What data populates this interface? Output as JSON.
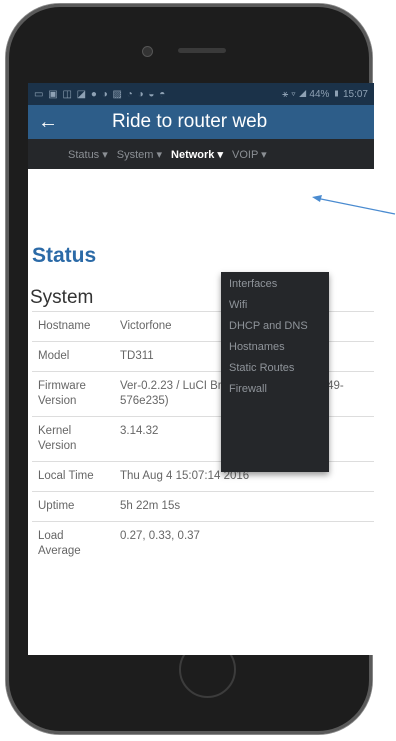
{
  "statusbar": {
    "left_icons": "▭ ▣ ◫ ◪ ● ◑ ▨ ◔ ◑ ◒ ◓",
    "right_text": "⚹ ▿ ◢ 44% ▮ 15:07"
  },
  "appbar": {
    "back_glyph": "←",
    "title": "Ride to router web"
  },
  "navbar": {
    "items": [
      {
        "label": "Status ▾"
      },
      {
        "label": "System ▾"
      },
      {
        "label": "Network ▾"
      },
      {
        "label": "VOIP ▾"
      }
    ]
  },
  "dropdown": {
    "items": [
      {
        "label": "Interfaces"
      },
      {
        "label": "Wifi"
      },
      {
        "label": "DHCP and DNS"
      },
      {
        "label": "Hostnames"
      },
      {
        "label": "Static Routes"
      },
      {
        "label": "Firewall"
      }
    ]
  },
  "page": {
    "heading": "Status",
    "section": "System"
  },
  "system_table": {
    "rows": [
      {
        "key": "Hostname",
        "value": "Victorfone"
      },
      {
        "key": "Model",
        "value": "TD311"
      },
      {
        "key": "Firmware Version",
        "value": "Ver-0.2.23 / LuCI Branch (git-15.090.50849-576e235)"
      },
      {
        "key": "Kernel Version",
        "value": "3.14.32"
      },
      {
        "key": "Local Time",
        "value": "Thu Aug 4 15:07:14 2016"
      },
      {
        "key": "Uptime",
        "value": "5h 22m 15s"
      },
      {
        "key": "Load Average",
        "value": "0.27, 0.33, 0.37"
      }
    ]
  },
  "colors": {
    "appbar": "#2d5d89",
    "navbar": "#25272a",
    "heading": "#2b6aa7",
    "callout": "#4a8bd0"
  }
}
